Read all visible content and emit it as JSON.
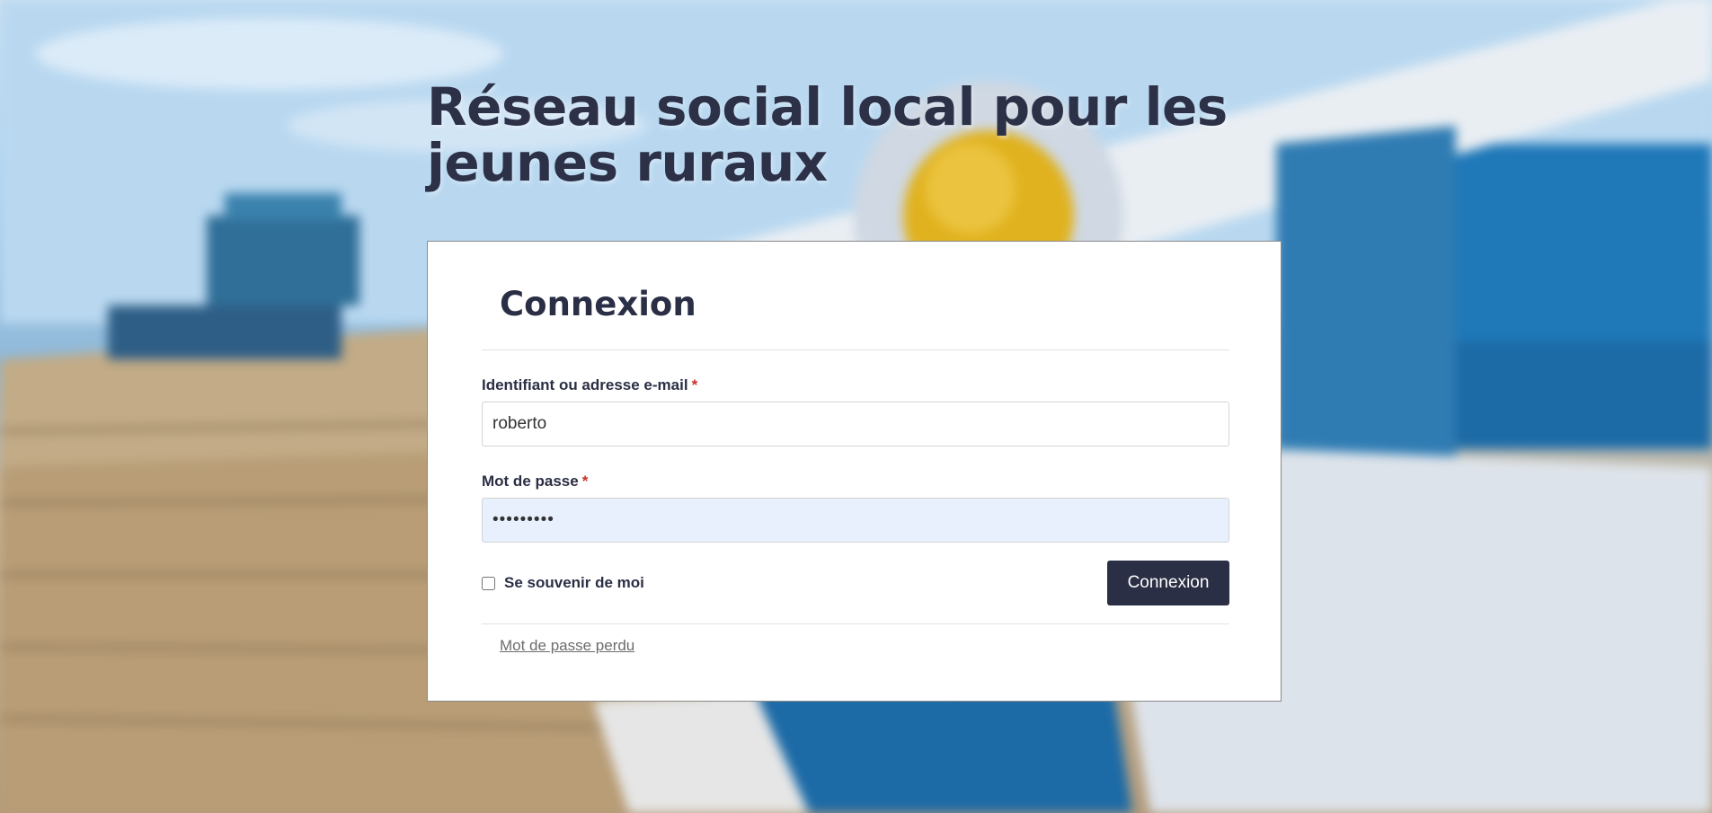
{
  "site": {
    "title": "Réseau social local pour les jeunes ruraux"
  },
  "login": {
    "heading": "Connexion",
    "username_label": "Identifiant ou adresse e-mail",
    "username_value": "roberto",
    "password_label": "Mot de passe",
    "password_value": "•••••••••",
    "required_mark": "*",
    "remember_label": "Se souvenir de moi",
    "submit_label": "Connexion",
    "lost_password_link": "Mot de passe perdu"
  },
  "colors": {
    "primary": "#2b2f45",
    "required": "#c4332b",
    "autofill": "#e8f0fe"
  }
}
